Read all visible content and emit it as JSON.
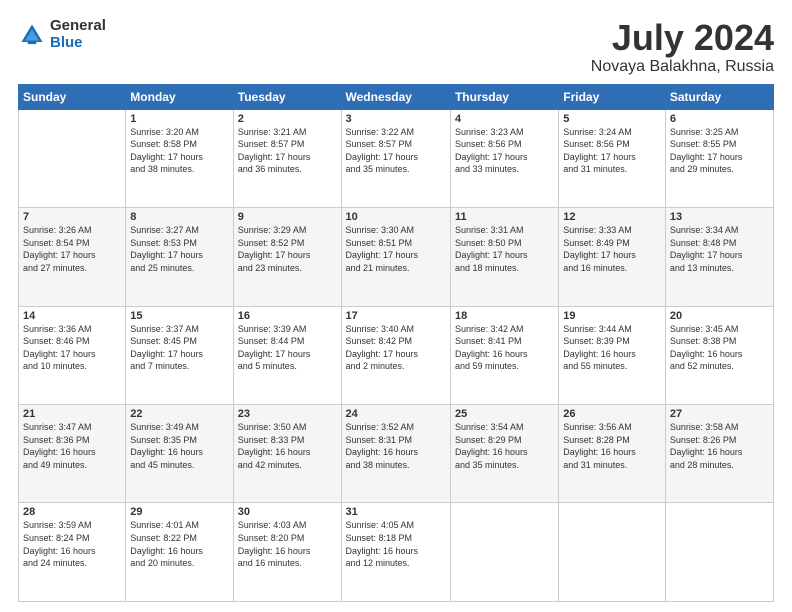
{
  "logo": {
    "general": "General",
    "blue": "Blue"
  },
  "title": {
    "month": "July 2024",
    "location": "Novaya Balakhna, Russia"
  },
  "calendar": {
    "headers": [
      "Sunday",
      "Monday",
      "Tuesday",
      "Wednesday",
      "Thursday",
      "Friday",
      "Saturday"
    ],
    "weeks": [
      [
        {
          "day": "",
          "info": ""
        },
        {
          "day": "1",
          "info": "Sunrise: 3:20 AM\nSunset: 8:58 PM\nDaylight: 17 hours\nand 38 minutes."
        },
        {
          "day": "2",
          "info": "Sunrise: 3:21 AM\nSunset: 8:57 PM\nDaylight: 17 hours\nand 36 minutes."
        },
        {
          "day": "3",
          "info": "Sunrise: 3:22 AM\nSunset: 8:57 PM\nDaylight: 17 hours\nand 35 minutes."
        },
        {
          "day": "4",
          "info": "Sunrise: 3:23 AM\nSunset: 8:56 PM\nDaylight: 17 hours\nand 33 minutes."
        },
        {
          "day": "5",
          "info": "Sunrise: 3:24 AM\nSunset: 8:56 PM\nDaylight: 17 hours\nand 31 minutes."
        },
        {
          "day": "6",
          "info": "Sunrise: 3:25 AM\nSunset: 8:55 PM\nDaylight: 17 hours\nand 29 minutes."
        }
      ],
      [
        {
          "day": "7",
          "info": "Sunrise: 3:26 AM\nSunset: 8:54 PM\nDaylight: 17 hours\nand 27 minutes."
        },
        {
          "day": "8",
          "info": "Sunrise: 3:27 AM\nSunset: 8:53 PM\nDaylight: 17 hours\nand 25 minutes."
        },
        {
          "day": "9",
          "info": "Sunrise: 3:29 AM\nSunset: 8:52 PM\nDaylight: 17 hours\nand 23 minutes."
        },
        {
          "day": "10",
          "info": "Sunrise: 3:30 AM\nSunset: 8:51 PM\nDaylight: 17 hours\nand 21 minutes."
        },
        {
          "day": "11",
          "info": "Sunrise: 3:31 AM\nSunset: 8:50 PM\nDaylight: 17 hours\nand 18 minutes."
        },
        {
          "day": "12",
          "info": "Sunrise: 3:33 AM\nSunset: 8:49 PM\nDaylight: 17 hours\nand 16 minutes."
        },
        {
          "day": "13",
          "info": "Sunrise: 3:34 AM\nSunset: 8:48 PM\nDaylight: 17 hours\nand 13 minutes."
        }
      ],
      [
        {
          "day": "14",
          "info": "Sunrise: 3:36 AM\nSunset: 8:46 PM\nDaylight: 17 hours\nand 10 minutes."
        },
        {
          "day": "15",
          "info": "Sunrise: 3:37 AM\nSunset: 8:45 PM\nDaylight: 17 hours\nand 7 minutes."
        },
        {
          "day": "16",
          "info": "Sunrise: 3:39 AM\nSunset: 8:44 PM\nDaylight: 17 hours\nand 5 minutes."
        },
        {
          "day": "17",
          "info": "Sunrise: 3:40 AM\nSunset: 8:42 PM\nDaylight: 17 hours\nand 2 minutes."
        },
        {
          "day": "18",
          "info": "Sunrise: 3:42 AM\nSunset: 8:41 PM\nDaylight: 16 hours\nand 59 minutes."
        },
        {
          "day": "19",
          "info": "Sunrise: 3:44 AM\nSunset: 8:39 PM\nDaylight: 16 hours\nand 55 minutes."
        },
        {
          "day": "20",
          "info": "Sunrise: 3:45 AM\nSunset: 8:38 PM\nDaylight: 16 hours\nand 52 minutes."
        }
      ],
      [
        {
          "day": "21",
          "info": "Sunrise: 3:47 AM\nSunset: 8:36 PM\nDaylight: 16 hours\nand 49 minutes."
        },
        {
          "day": "22",
          "info": "Sunrise: 3:49 AM\nSunset: 8:35 PM\nDaylight: 16 hours\nand 45 minutes."
        },
        {
          "day": "23",
          "info": "Sunrise: 3:50 AM\nSunset: 8:33 PM\nDaylight: 16 hours\nand 42 minutes."
        },
        {
          "day": "24",
          "info": "Sunrise: 3:52 AM\nSunset: 8:31 PM\nDaylight: 16 hours\nand 38 minutes."
        },
        {
          "day": "25",
          "info": "Sunrise: 3:54 AM\nSunset: 8:29 PM\nDaylight: 16 hours\nand 35 minutes."
        },
        {
          "day": "26",
          "info": "Sunrise: 3:56 AM\nSunset: 8:28 PM\nDaylight: 16 hours\nand 31 minutes."
        },
        {
          "day": "27",
          "info": "Sunrise: 3:58 AM\nSunset: 8:26 PM\nDaylight: 16 hours\nand 28 minutes."
        }
      ],
      [
        {
          "day": "28",
          "info": "Sunrise: 3:59 AM\nSunset: 8:24 PM\nDaylight: 16 hours\nand 24 minutes."
        },
        {
          "day": "29",
          "info": "Sunrise: 4:01 AM\nSunset: 8:22 PM\nDaylight: 16 hours\nand 20 minutes."
        },
        {
          "day": "30",
          "info": "Sunrise: 4:03 AM\nSunset: 8:20 PM\nDaylight: 16 hours\nand 16 minutes."
        },
        {
          "day": "31",
          "info": "Sunrise: 4:05 AM\nSunset: 8:18 PM\nDaylight: 16 hours\nand 12 minutes."
        },
        {
          "day": "",
          "info": ""
        },
        {
          "day": "",
          "info": ""
        },
        {
          "day": "",
          "info": ""
        }
      ]
    ]
  }
}
